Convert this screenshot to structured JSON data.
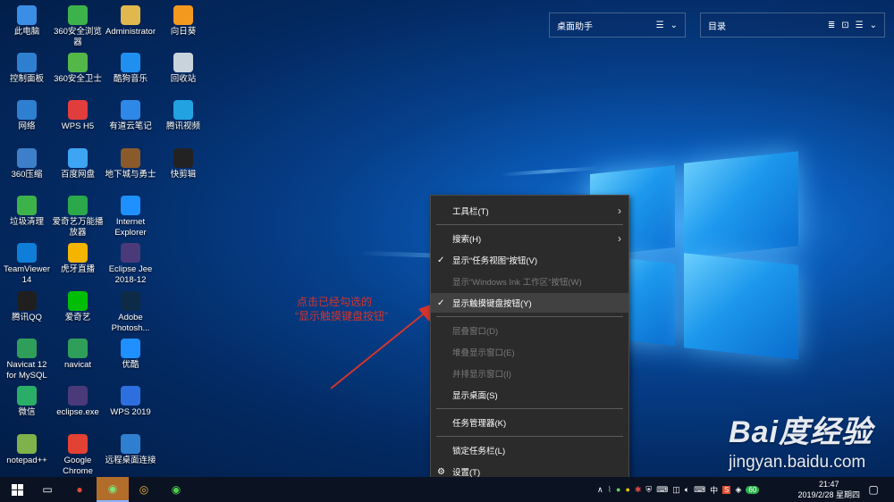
{
  "desktop_icons": [
    {
      "label": "此电脑",
      "icon": "computer-icon",
      "color": "#3a8ee6"
    },
    {
      "label": "360安全浏览器",
      "icon": "browser-360-icon",
      "color": "#3cb34a"
    },
    {
      "label": "Administrator",
      "icon": "user-folder-icon",
      "color": "#e0b84d"
    },
    {
      "label": "向日葵",
      "icon": "sunflower-icon",
      "color": "#f39a1e"
    },
    {
      "label": "控制面板",
      "icon": "control-panel-icon",
      "color": "#2f7fd1"
    },
    {
      "label": "360安全卫士",
      "icon": "shield-360-icon",
      "color": "#53b848"
    },
    {
      "label": "酷狗音乐",
      "icon": "kugou-icon",
      "color": "#1f8ff0"
    },
    {
      "label": "回收站",
      "icon": "recycle-bin-icon",
      "color": "#c9d3dc"
    },
    {
      "label": "网络",
      "icon": "network-icon",
      "color": "#2f7fd1"
    },
    {
      "label": "WPS H5",
      "icon": "wps-h5-icon",
      "color": "#e23d3d"
    },
    {
      "label": "有道云笔记",
      "icon": "youdao-note-icon",
      "color": "#2e88e8"
    },
    {
      "label": "腾讯视频",
      "icon": "tencent-video-icon",
      "color": "#22a2e0"
    },
    {
      "label": "360压缩",
      "icon": "archive-icon",
      "color": "#3d7fc9"
    },
    {
      "label": "百度网盘",
      "icon": "baidu-pan-icon",
      "color": "#3da5f2"
    },
    {
      "label": "地下城与勇士",
      "icon": "dnf-game-icon",
      "color": "#8a5a2b"
    },
    {
      "label": "快剪辑",
      "icon": "video-clip-icon",
      "color": "#222222"
    },
    {
      "label": "垃圾清理",
      "icon": "cleanup-icon",
      "color": "#3cb34a"
    },
    {
      "label": "爱奇艺万能播放器",
      "icon": "iqiyi-player-icon",
      "color": "#2aa84a"
    },
    {
      "label": "Internet Explorer",
      "icon": "ie-icon",
      "color": "#1e90ff"
    },
    {
      "label": "",
      "icon": "blank",
      "color": "transparent"
    },
    {
      "label": "TeamViewer 14",
      "icon": "teamviewer-icon",
      "color": "#0e7ed8"
    },
    {
      "label": "虎牙直播",
      "icon": "huya-icon",
      "color": "#f5b400"
    },
    {
      "label": "Eclipse Jee 2018-12",
      "icon": "eclipse-icon",
      "color": "#4b3a7a"
    },
    {
      "label": "",
      "icon": "blank",
      "color": "transparent"
    },
    {
      "label": "腾讯QQ",
      "icon": "qq-icon",
      "color": "#1f1f1f"
    },
    {
      "label": "爱奇艺",
      "icon": "iqiyi-icon",
      "color": "#00be06"
    },
    {
      "label": "Adobe Photosh...",
      "icon": "photoshop-icon",
      "color": "#0d2b47"
    },
    {
      "label": "",
      "icon": "blank",
      "color": "transparent"
    },
    {
      "label": "Navicat 12 for MySQL",
      "icon": "navicat-icon",
      "color": "#2f9e5a"
    },
    {
      "label": "navicat",
      "icon": "navicat-icon",
      "color": "#2f9e5a"
    },
    {
      "label": "优酷",
      "icon": "youku-icon",
      "color": "#1e90ff"
    },
    {
      "label": "",
      "icon": "blank",
      "color": "transparent"
    },
    {
      "label": "微信",
      "icon": "wechat-icon",
      "color": "#2aae67"
    },
    {
      "label": "eclipse.exe",
      "icon": "eclipse-icon",
      "color": "#4b3a7a"
    },
    {
      "label": "WPS 2019",
      "icon": "wps-icon",
      "color": "#2e6fe0"
    },
    {
      "label": "",
      "icon": "blank",
      "color": "transparent"
    },
    {
      "label": "notepad++",
      "icon": "notepad-plus-icon",
      "color": "#7fb24a"
    },
    {
      "label": "Google Chrome",
      "icon": "chrome-icon",
      "color": "#e34133"
    },
    {
      "label": "远程桌面连接",
      "icon": "remote-desktop-icon",
      "color": "#2f7fd1"
    }
  ],
  "widgets": {
    "desktop_helper": {
      "title": "桌面助手"
    },
    "catalog": {
      "title": "目录"
    }
  },
  "context_menu": {
    "items": [
      {
        "label": "工具栏(T)",
        "state": "normal",
        "submenu": true,
        "checked": false
      },
      {
        "label": "搜索(H)",
        "state": "normal",
        "submenu": true,
        "checked": false
      },
      {
        "label": "显示“任务视图”按钮(V)",
        "state": "normal",
        "submenu": false,
        "checked": true
      },
      {
        "label": "显示“Windows Ink 工作区”按钮(W)",
        "state": "disabled",
        "submenu": false,
        "checked": false
      },
      {
        "label": "显示触摸键盘按钮(Y)",
        "state": "hover",
        "submenu": false,
        "checked": true
      },
      {
        "label": "层叠窗口(D)",
        "state": "disabled",
        "submenu": false,
        "checked": false
      },
      {
        "label": "堆叠显示窗口(E)",
        "state": "disabled",
        "submenu": false,
        "checked": false
      },
      {
        "label": "并排显示窗口(I)",
        "state": "disabled",
        "submenu": false,
        "checked": false
      },
      {
        "label": "显示桌面(S)",
        "state": "normal",
        "submenu": false,
        "checked": false
      },
      {
        "label": "任务管理器(K)",
        "state": "normal",
        "submenu": false,
        "checked": false
      },
      {
        "label": "锁定任务栏(L)",
        "state": "normal",
        "submenu": false,
        "checked": false
      },
      {
        "label": "设置(T)",
        "state": "normal",
        "submenu": false,
        "checked": false,
        "icon": "gear-icon"
      }
    ]
  },
  "annotation": {
    "line1": "点击已经勾选的",
    "line2": "“显示触摸键盘按钮”",
    "color": "#d4342b"
  },
  "taskbar": {
    "input_method": "中",
    "badge": "60",
    "time": "21:47",
    "date": "2019/2/28 星期四"
  },
  "watermark": {
    "brand": "Bai度经验",
    "url": "jingyan.baidu.com"
  }
}
